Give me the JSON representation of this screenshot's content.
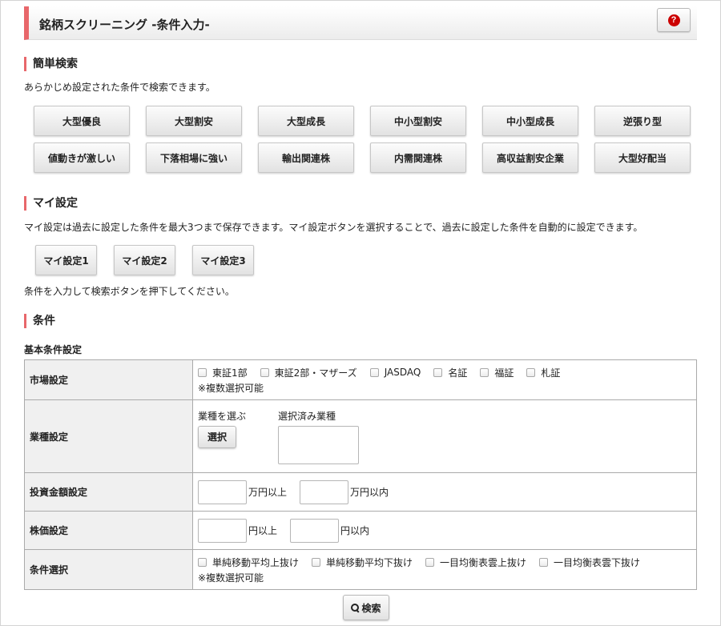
{
  "header": {
    "title": "銘柄スクリーニング -条件入力-",
    "help_icon": "?"
  },
  "simple_search": {
    "heading": "簡単検索",
    "description": "あらかじめ設定された条件で検索できます。",
    "presets": [
      "大型優良",
      "大型割安",
      "大型成長",
      "中小型割安",
      "中小型成長",
      "逆張り型",
      "値動きが激しい",
      "下落相場に強い",
      "輸出関連株",
      "内需関連株",
      "高収益割安企業",
      "大型好配当"
    ]
  },
  "my_settings": {
    "heading": "マイ設定",
    "description": "マイ設定は過去に設定した条件を最大3つまで保存できます。マイ設定ボタンを選択することで、過去に設定した条件を自動的に設定できます。",
    "buttons": [
      "マイ設定1",
      "マイ設定2",
      "マイ設定3"
    ],
    "instruction": "条件を入力して検索ボタンを押下してください。"
  },
  "conditions": {
    "heading": "条件",
    "subheading": "基本条件設定",
    "market": {
      "label": "市場設定",
      "options": [
        "東証1部",
        "東証2部・マザーズ",
        "JASDAQ",
        "名証",
        "福証",
        "札証"
      ],
      "note": "※複数選択可能"
    },
    "industry": {
      "label": "業種設定",
      "choose_label": "業種を選ぶ",
      "select_button": "選択",
      "selected_label": "選択済み業種"
    },
    "investment": {
      "label": "投資金額設定",
      "min_unit": "万円以上",
      "max_unit": "万円以内"
    },
    "price": {
      "label": "株価設定",
      "min_unit": "円以上",
      "max_unit": "円以内"
    },
    "condition_select": {
      "label": "条件選択",
      "options": [
        "単純移動平均上抜け",
        "単純移動平均下抜け",
        "一目均衡表雲上抜け",
        "一目均衡表雲下抜け"
      ],
      "note": "※複数選択可能"
    },
    "search_button": "検索"
  },
  "colors": {
    "accent": "#e8676b",
    "help_icon": "#cc0000"
  }
}
